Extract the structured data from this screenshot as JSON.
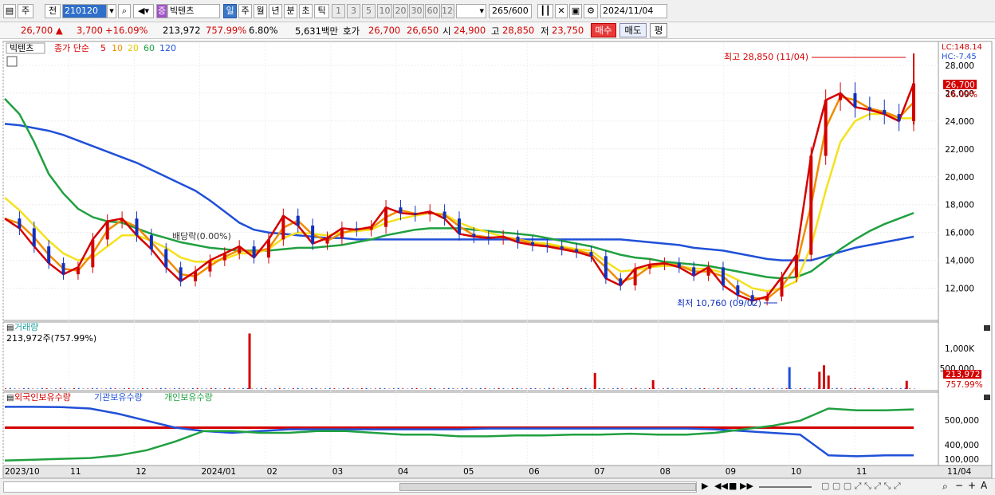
{
  "toolbar": {
    "period_main": "주",
    "prev_label": "전",
    "code": "210120",
    "badge": "증",
    "stock_name": "빅텐츠",
    "periods": [
      "일",
      "주",
      "월",
      "년",
      "분",
      "초",
      "틱"
    ],
    "active_period": "일",
    "minutes": [
      "1",
      "3",
      "5",
      "10",
      "20",
      "30",
      "60",
      "120"
    ],
    "count": "265",
    "count_total": "/600",
    "date": "2024/11/04"
  },
  "quote": {
    "price": "26,700",
    "change": "3,700",
    "change_pct": "+16.09%",
    "volume": "213,972",
    "volume_ratio": "757.99%",
    "turnover": "6.80%",
    "amount": "5,631백만",
    "bid_label": "호가",
    "ask": "26,700",
    "bid": "26,650",
    "open_label": "시",
    "open": "24,900",
    "high_label": "고",
    "high": "28,850",
    "low_label": "저",
    "low": "23,750",
    "buy_label": "매수",
    "sell_label": "매도",
    "avg_label": "평"
  },
  "chart_data": {
    "type": "line",
    "title": "빅텐츠",
    "price_legend": [
      "종가 단순",
      "5",
      "10",
      "20",
      "60",
      "120"
    ],
    "ma_colors": {
      "close": "#d40000",
      "ma5": "#d40000",
      "ma10": "#f08c00",
      "ma20": "#f5e11e",
      "ma60": "#20a040",
      "ma120": "#2050d8"
    },
    "lc_label": "LC:148.14",
    "hc_label": "HC:-7.45",
    "y_ticks": [
      28000,
      26000,
      24000,
      22000,
      20000,
      18000,
      16000,
      14000,
      12000
    ],
    "ylim": [
      9800,
      29600
    ],
    "current_price_label": "26,700",
    "current_pct_label": "16.09%",
    "high_annotation": "최고 28,850 (11/04)",
    "low_annotation": "최저 10,760 (09/02)",
    "dividend_annotation": "배당락(0.00%)",
    "x_labels": [
      "2023/10",
      "11",
      "12",
      "2024/01",
      "02",
      "03",
      "04",
      "05",
      "06",
      "07",
      "08",
      "09",
      "10",
      "11",
      "11/04"
    ],
    "series_close": [
      17000,
      16300,
      15000,
      13800,
      13000,
      13500,
      15500,
      16800,
      17000,
      15800,
      14800,
      13500,
      12500,
      13200,
      14000,
      14500,
      15000,
      14200,
      15500,
      17200,
      16500,
      15200,
      15600,
      16300,
      16200,
      16400,
      17800,
      17400,
      17300,
      17500,
      17000,
      15900,
      15700,
      15600,
      15700,
      15300,
      15100,
      15000,
      14800,
      14600,
      14300,
      12700,
      12200,
      13400,
      13700,
      13800,
      13500,
      12900,
      13500,
      12200,
      11500,
      11100,
      11400,
      12800,
      14400,
      21500,
      25500,
      26000,
      25000,
      24800,
      24500,
      24000,
      26700
    ],
    "series_ma20": [
      18500,
      17600,
      16500,
      15400,
      14500,
      14000,
      14200,
      15000,
      15800,
      15800,
      15400,
      14900,
      14200,
      13900,
      13900,
      14100,
      14500,
      14500,
      14800,
      15600,
      16000,
      15900,
      15800,
      16000,
      16100,
      16200,
      16700,
      17000,
      17200,
      17400,
      17300,
      16700,
      16300,
      16000,
      15700,
      15500,
      15300,
      15200,
      15000,
      14800,
      14700,
      13900,
      13200,
      13300,
      13500,
      13600,
      13600,
      13400,
      13400,
      13100,
      12600,
      12000,
      11800,
      12000,
      12500,
      15000,
      19000,
      22500,
      24000,
      24500,
      24500,
      24200,
      24200
    ],
    "series_ma60": [
      25600,
      24500,
      22500,
      20200,
      18800,
      17700,
      17100,
      16800,
      16700,
      16300,
      15900,
      15600,
      15300,
      15100,
      14900,
      14800,
      14700,
      14700,
      14700,
      14800,
      14900,
      14900,
      15000,
      15100,
      15300,
      15500,
      15800,
      16000,
      16200,
      16300,
      16300,
      16300,
      16200,
      16100,
      16000,
      15900,
      15800,
      15600,
      15400,
      15200,
      15000,
      14700,
      14400,
      14200,
      14100,
      13900,
      13800,
      13700,
      13600,
      13400,
      13200,
      13000,
      12800,
      12700,
      12800,
      13200,
      14000,
      14800,
      15500,
      16100,
      16600,
      17000,
      17400
    ],
    "series_ma120": [
      23800,
      23700,
      23500,
      23300,
      23000,
      22600,
      22200,
      21800,
      21400,
      21000,
      20500,
      20000,
      19500,
      19000,
      18300,
      17500,
      16700,
      16200,
      16000,
      15900,
      15800,
      15700,
      15600,
      15600,
      15500,
      15500,
      15500,
      15500,
      15500,
      15500,
      15500,
      15500,
      15500,
      15500,
      15500,
      15500,
      15500,
      15500,
      15500,
      15500,
      15500,
      15500,
      15500,
      15400,
      15300,
      15200,
      15100,
      14900,
      14800,
      14700,
      14500,
      14300,
      14100,
      14000,
      14000,
      14000,
      14300,
      14600,
      14900,
      15100,
      15300,
      15500,
      15700
    ],
    "volume_title": "거래량",
    "volume_value_label": "213,972주(757.99%)",
    "volume_ticks": [
      "1,000K",
      "500,000"
    ],
    "volume_current_label": "213,972",
    "volume_pct_label": "757.99%",
    "volume_spikes": [
      {
        "pos": 0.268,
        "value": 1450000,
        "color": "#d40000"
      },
      {
        "pos": 0.648,
        "value": 420000,
        "color": "#d40000"
      },
      {
        "pos": 0.712,
        "value": 230000,
        "color": "#d40000"
      },
      {
        "pos": 0.862,
        "value": 570000,
        "color": "#2050d8"
      },
      {
        "pos": 0.895,
        "value": 450000,
        "color": "#d40000"
      },
      {
        "pos": 0.9,
        "value": 620000,
        "color": "#d40000"
      },
      {
        "pos": 0.905,
        "value": 350000,
        "color": "#d40000"
      },
      {
        "pos": 0.991,
        "value": 213972,
        "color": "#d40000"
      }
    ],
    "holding_legend": [
      "외국인보유수량",
      "기관보유수량",
      "개인보유수량"
    ],
    "holding_colors": [
      "#d40000",
      "#2050d8",
      "#20a040"
    ],
    "holding_ticks": [
      "500,000",
      "400,000",
      "100,000"
    ],
    "foreign_level": 460000,
    "institution_series": [
      580000,
      580000,
      578000,
      570000,
      540000,
      500000,
      460000,
      440000,
      430000,
      440000,
      450000,
      450000,
      450000,
      450000,
      450000,
      450000,
      450000,
      455000,
      455000,
      455000,
      455000,
      455000,
      455000,
      455000,
      455000,
      450000,
      440000,
      430000,
      420000,
      300000,
      295000,
      300000,
      300000
    ],
    "individual_series": [
      270000,
      275000,
      280000,
      285000,
      300000,
      330000,
      380000,
      440000,
      440000,
      430000,
      430000,
      440000,
      440000,
      430000,
      420000,
      420000,
      410000,
      410000,
      415000,
      415000,
      420000,
      420000,
      425000,
      420000,
      420000,
      430000,
      450000,
      470000,
      500000,
      570000,
      560000,
      560000,
      565000
    ]
  },
  "bottom": {
    "zoom_out": "−",
    "zoom_in": "+",
    "auto": "A"
  }
}
